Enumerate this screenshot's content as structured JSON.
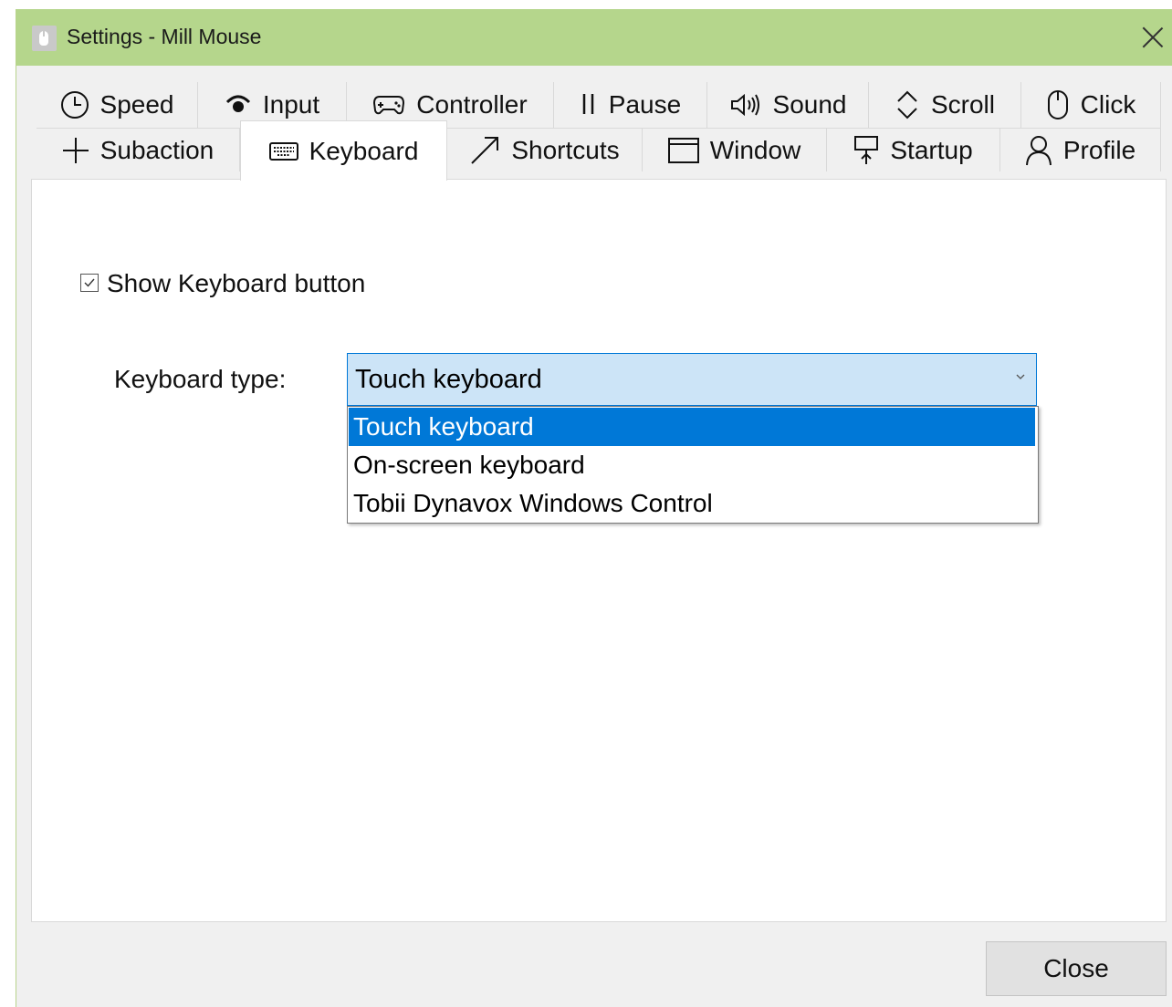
{
  "window": {
    "title": "Settings - Mill Mouse",
    "accent_color": "#b5d68c"
  },
  "tabs_row1": [
    {
      "label": "Speed",
      "icon": "clock-icon"
    },
    {
      "label": "Input",
      "icon": "signal-icon"
    },
    {
      "label": "Controller",
      "icon": "gamepad-icon"
    },
    {
      "label": "Pause",
      "icon": "pause-icon"
    },
    {
      "label": "Sound",
      "icon": "speaker-icon"
    },
    {
      "label": "Scroll",
      "icon": "scroll-arrows-icon"
    },
    {
      "label": "Click",
      "icon": "mouse-icon"
    }
  ],
  "tabs_row2": [
    {
      "label": "Subaction",
      "icon": "plus-icon"
    },
    {
      "label": "Keyboard",
      "icon": "keyboard-icon",
      "active": true
    },
    {
      "label": "Shortcuts",
      "icon": "arrow-diagonal-icon"
    },
    {
      "label": "Window",
      "icon": "window-icon"
    },
    {
      "label": "Startup",
      "icon": "startup-icon"
    },
    {
      "label": "Profile",
      "icon": "person-icon"
    }
  ],
  "keyboard_settings": {
    "show_keyboard_label": "Show Keyboard button",
    "show_keyboard_checked": true,
    "keyboard_type_label": "Keyboard type:",
    "keyboard_type_value": "Touch keyboard",
    "options": [
      "Touch keyboard",
      "On-screen keyboard",
      "Tobii Dynavox Windows Control"
    ],
    "selected_option": "Touch keyboard",
    "selection_color": "#0078d7"
  },
  "footer": {
    "close_label": "Close"
  }
}
